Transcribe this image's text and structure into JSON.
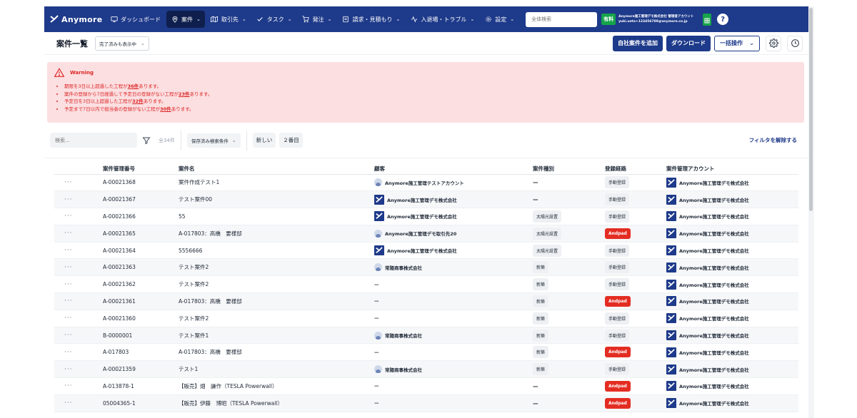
{
  "nav": {
    "brand": "Anymore",
    "items": [
      {
        "label": "ダッシュボード",
        "icon": "monitor-icon",
        "chevron": false
      },
      {
        "label": "案件",
        "icon": "pin-icon",
        "chevron": true,
        "active": true
      },
      {
        "label": "取引先",
        "icon": "map-icon",
        "chevron": true
      },
      {
        "label": "タスク",
        "icon": "check-icon",
        "chevron": true
      },
      {
        "label": "発注",
        "icon": "cart-icon",
        "chevron": true
      },
      {
        "label": "請求・見積もり",
        "icon": "document-icon",
        "chevron": true
      },
      {
        "label": "入退場・トラブル",
        "icon": "activity-icon",
        "chevron": true
      },
      {
        "label": "設定",
        "icon": "gear-icon",
        "chevron": true
      }
    ],
    "search_placeholder": "全体検索",
    "plan_badge": "有料",
    "account_line1": "Anymore施工管理デモ株式会社 管理者アカウント",
    "account_line2": "yuki.ueta+123456789@anymore.co.jp",
    "help": "?"
  },
  "header": {
    "title": "案件一覧",
    "show_completed": "完了済みも表示中",
    "add_button": "自社案件を追加",
    "download_button": "ダウンロード",
    "bulk_button": "一括操作"
  },
  "warning": {
    "title": "Warning",
    "items": [
      {
        "before": "期限を3日以上超過した工程が",
        "count": "36件",
        "after": "あります。"
      },
      {
        "before": "案件の登録から7日経過して予定日の登録がない工程が",
        "count": "23件",
        "after": "あります。"
      },
      {
        "before": "予定日を3日以上超過した工程が",
        "count": "32件",
        "after": "あります。"
      },
      {
        "before": "予定まで7日以内で担当者の登録がない工程が",
        "count": "30件",
        "after": "あります。"
      }
    ]
  },
  "filter": {
    "search_placeholder": "検索...",
    "total": "全34件",
    "saved": "保存済み検索条件",
    "sort_new": "新しい",
    "sort_second": "２番目",
    "clear": "フィルタを解除する"
  },
  "table": {
    "headers": [
      "",
      "案件管理番号",
      "案件名",
      "顧客",
      "案件種別",
      "登録経路",
      "案件管理アカウント"
    ],
    "rows": [
      {
        "dots": "···",
        "id": "A-00021368",
        "name": "案件作成テスト1",
        "customer": "Anymore施工管理テストアカウント",
        "cust_type": "person",
        "kind": "—",
        "route": "手動登録",
        "route_type": "manual",
        "account": "Anymore施工管理デモ株式会社"
      },
      {
        "dots": "···",
        "id": "A-00021367",
        "name": "テスト案件00",
        "customer": "Anymore施工管理デモ株式会社",
        "cust_type": "company",
        "kind": "—",
        "route": "手動登録",
        "route_type": "manual",
        "account": "Anymore施工管理デモ株式会社"
      },
      {
        "dots": "···",
        "id": "A-00021366",
        "name": "55",
        "customer": "Anymore施工管理デモ株式会社",
        "cust_type": "company",
        "kind": "太陽光設置",
        "route": "手動登録",
        "route_type": "manual",
        "account": "Anymore施工管理デモ株式会社"
      },
      {
        "dots": "···",
        "id": "A-00021365",
        "name": "A-017803：高橋　要様邸",
        "customer": "Anymore施工管理デモ取引先20",
        "cust_type": "person",
        "kind": "太陽光設置",
        "route": "Andpad",
        "route_type": "andpad",
        "account": "Anymore施工管理デモ株式会社"
      },
      {
        "dots": "···",
        "id": "A-00021364",
        "name": "5556666",
        "customer": "Anymore施工管理デモ株式会社",
        "cust_type": "company",
        "kind": "太陽光設置",
        "route": "手動登録",
        "route_type": "manual",
        "account": "Anymore施工管理デモ株式会社"
      },
      {
        "dots": "···",
        "id": "A-00021363",
        "name": "テスト案件2",
        "customer": "常陽商事株式会社",
        "cust_type": "person",
        "kind": "新築",
        "route": "手動登録",
        "route_type": "manual",
        "account": "Anymore施工管理デモ株式会社"
      },
      {
        "dots": "···",
        "id": "A-00021362",
        "name": "テスト案件2",
        "customer": "—",
        "cust_type": "none",
        "kind": "新築",
        "route": "手動登録",
        "route_type": "manual",
        "account": "Anymore施工管理デモ株式会社"
      },
      {
        "dots": "···",
        "id": "A-00021361",
        "name": "A-017803：高橋　要様邸",
        "customer": "—",
        "cust_type": "none",
        "kind": "新築",
        "route": "Andpad",
        "route_type": "andpad",
        "account": "Anymore施工管理デモ株式会社"
      },
      {
        "dots": "···",
        "id": "A-00021360",
        "name": "テスト案件2",
        "customer": "—",
        "cust_type": "none",
        "kind": "新築",
        "route": "手動登録",
        "route_type": "manual",
        "account": "Anymore施工管理デモ株式会社"
      },
      {
        "dots": "···",
        "id": "B-0000001",
        "name": "テスト案件1",
        "customer": "常陽商事株式会社",
        "cust_type": "person",
        "kind": "新築",
        "route": "手動登録",
        "route_type": "manual",
        "account": "Anymore施工管理デモ株式会社"
      },
      {
        "dots": "···",
        "id": "A-017803",
        "name": "A-017803：高橋　要様邸",
        "customer": "—",
        "cust_type": "none",
        "kind": "新築",
        "route": "Andpad",
        "route_type": "andpad",
        "account": "Anymore施工管理デモ株式会社"
      },
      {
        "dots": "···",
        "id": "A-00021359",
        "name": "テスト1",
        "customer": "常陽商事株式会社",
        "cust_type": "person",
        "kind": "新築",
        "route": "手動登録",
        "route_type": "manual",
        "account": "Anymore施工管理デモ株式会社"
      },
      {
        "dots": "···",
        "id": "A-013878-1",
        "name": "【販売】畑　謙作（TESLA Powerwall）",
        "customer": "—",
        "cust_type": "none",
        "kind": "—",
        "route": "Andpad",
        "route_type": "andpad",
        "account": "Anymore施工管理デモ株式会社"
      },
      {
        "dots": "···",
        "id": "05004365-1",
        "name": "【販売】伊藤　博昭（TESLA Powerwall）",
        "customer": "—",
        "cust_type": "none",
        "kind": "—",
        "route": "Andpad",
        "route_type": "andpad",
        "account": "Anymore施工管理デモ株式会社"
      }
    ]
  },
  "colors": {
    "nav_bg": "#1e3a8a",
    "warning_bg": "#fcdfe1",
    "warning_text": "#dc2626",
    "andpad": "#e42d22",
    "plan_badge": "#16a34a"
  }
}
